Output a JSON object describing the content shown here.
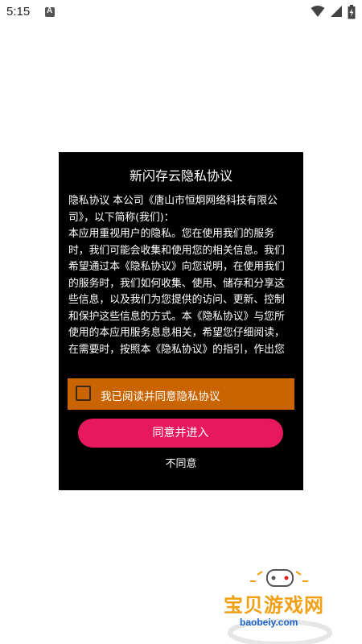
{
  "status_bar": {
    "time": "5:15",
    "notification_letter": "A"
  },
  "dialog": {
    "title": "新闪存云隐私协议",
    "body": "隐私协议 本公司《唐山市恒炯网络科技有限公司》，以下简称(我们)：\n本应用重视用户的隐私。您在使用我们的服务时，我们可能会收集和使用您的相关信息。我们希望通过本《隐私协议》向您说明，在使用我们的服务时，我们如何收集、使用、储存和分享这些信息，以及我们为您提供的访问、更新、控制和保护这些信息的方式。本《隐私协议》与您所使用的本应用服务息息相关，希望您仔细阅读，在需要时，按照本《隐私协议》的指引，作出您认为适当的选择。本《隐私协议》中涉及的相关",
    "agree_checkbox_label": "我已阅读并同意隐私协议",
    "agree_button": "同意并进入",
    "disagree": "不同意"
  },
  "colors": {
    "agree_row": "#c96400",
    "agree_button": "#e8185e",
    "dialog_bg": "#000000"
  },
  "watermark": {
    "text": "宝贝游戏网",
    "url": "baobeiy.com"
  }
}
